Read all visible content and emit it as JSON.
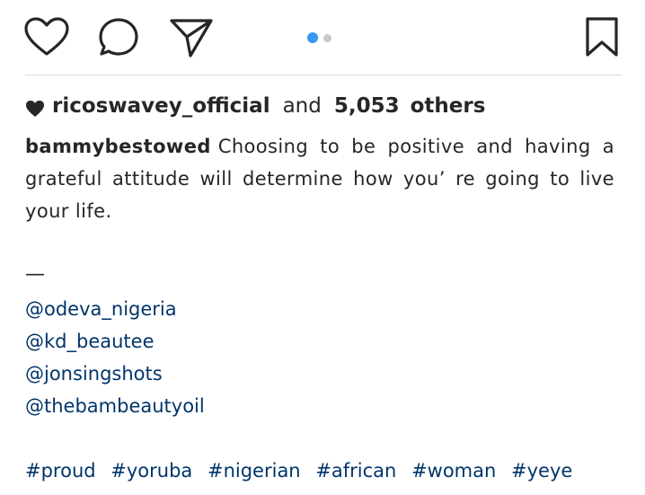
{
  "actions": {
    "like_icon": "heart-outline",
    "comment_icon": "comment-bubble",
    "share_icon": "paper-plane",
    "save_icon": "bookmark",
    "carousel": {
      "total": 2,
      "active_index": 0
    },
    "accent_color": "#3897f0"
  },
  "likes": {
    "user": "ricoswavey_official",
    "and_text": "and",
    "count": "5,053",
    "others_text": "others"
  },
  "caption": {
    "username": "bammybestowed",
    "text": "Choosing to be positive and having a grateful attitude will determine how you’ re going to live your life."
  },
  "separator": "—",
  "mentions": [
    "@odeva_nigeria",
    "@kd_beautee",
    "@jonsingshots",
    "@thebambeautyoil"
  ],
  "hashtags": [
    "#proud",
    "#yoruba",
    "#nigerian",
    "#african",
    "#woman",
    "#yeye"
  ],
  "link_color": "#003569"
}
